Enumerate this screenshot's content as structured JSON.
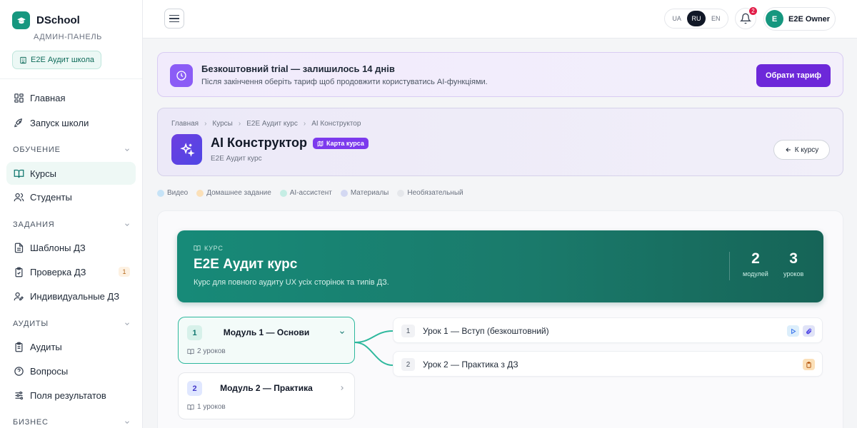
{
  "sidebar": {
    "brand": "DSchool",
    "brand_sub": "АДМИН-ПАНЕЛЬ",
    "school": "E2E Аудит школа",
    "items": [
      {
        "label": "Главная"
      },
      {
        "label": "Запуск школи"
      },
      {
        "label": "Курсы"
      },
      {
        "label": "Студенты"
      },
      {
        "label": "Шаблоны ДЗ"
      },
      {
        "label": "Проверка ДЗ",
        "badge": "1"
      },
      {
        "label": "Индивидуальные ДЗ"
      },
      {
        "label": "Аудиты"
      },
      {
        "label": "Вопросы"
      },
      {
        "label": "Поля результатов"
      }
    ],
    "sections": [
      "ОБУЧЕНИЕ",
      "ЗАДАНИЯ",
      "АУДИТЫ",
      "БИЗНЕС"
    ]
  },
  "topbar": {
    "langs": [
      "UA",
      "RU",
      "EN"
    ],
    "active_lang": "RU",
    "notifications": "2",
    "user_initial": "E",
    "user_name": "E2E Owner"
  },
  "trial": {
    "title": "Безкоштовний trial — залишилось 14 днів",
    "subtitle": "Після закінчення оберіть тариф щоб продовжити користуватись AI-функціями.",
    "button": "Обрати тариф"
  },
  "header": {
    "breadcrumbs": [
      "Главная",
      "Курсы",
      "E2E Аудит курс",
      "AI Конструктор"
    ],
    "title": "AI Конструктор",
    "map_chip": "Карта курса",
    "subtitle": "E2E Аудит курс",
    "back": "К курсу"
  },
  "legend": [
    {
      "label": "Видео",
      "color": "#c6e3f7"
    },
    {
      "label": "Домашнее задание",
      "color": "#fbe0b8"
    },
    {
      "label": "AI-ассистент",
      "color": "#c5ede4"
    },
    {
      "label": "Материалы",
      "color": "#d3d8f2"
    },
    {
      "label": "Необязательный",
      "color": "#e5e7eb"
    }
  ],
  "course": {
    "kicker": "КУРС",
    "title": "E2E Аудит курс",
    "subtitle": "Курс для повного аудиту UX усіх сторінок та типів ДЗ.",
    "modules_count": "2",
    "modules_label": "модулей",
    "lessons_count": "3",
    "lessons_label": "уроков"
  },
  "modules": [
    {
      "num": "1",
      "title": "Модуль 1 — Основи",
      "meta": "2 уроков"
    },
    {
      "num": "2",
      "title": "Модуль 2 — Практика",
      "meta": "1 уроков"
    }
  ],
  "lessons": [
    {
      "num": "1",
      "title": "Урок 1 — Вступ (безкоштовний)"
    },
    {
      "num": "2",
      "title": "Урок 2 — Практика з ДЗ"
    }
  ],
  "colors": {
    "accent": "#16977f",
    "purple": "#6d28d9",
    "badge": "#e11d48"
  }
}
